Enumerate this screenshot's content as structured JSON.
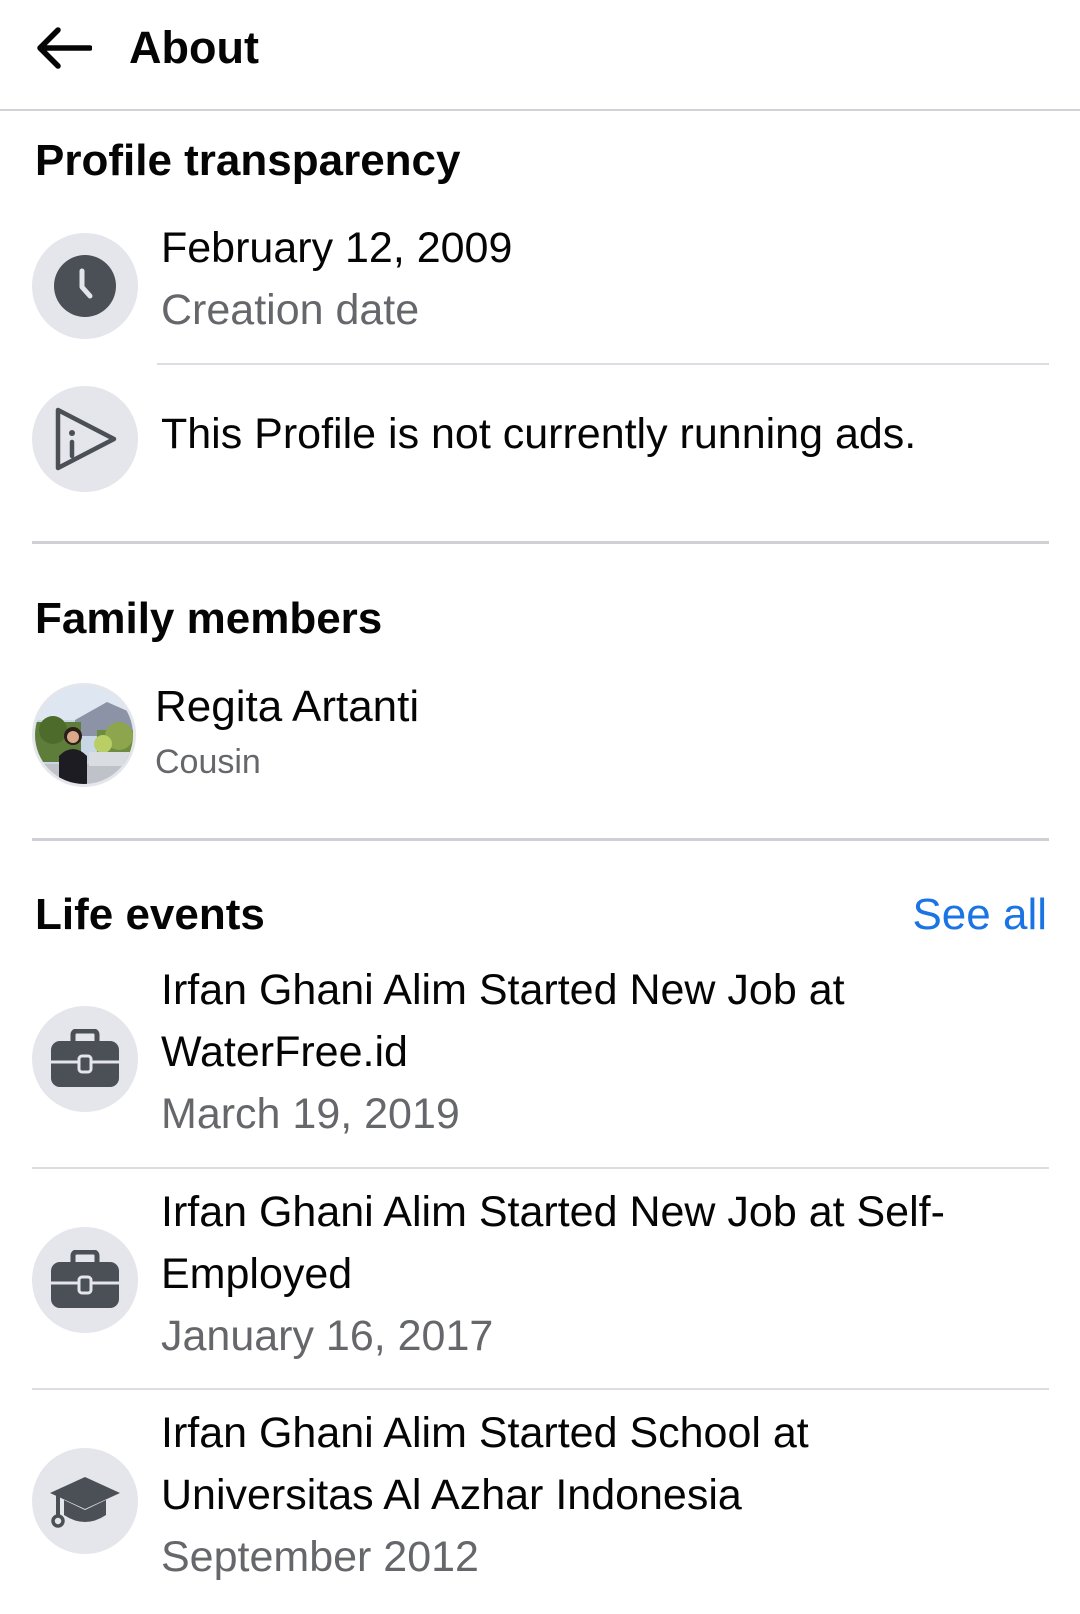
{
  "header": {
    "title": "About",
    "back_icon": "arrow-left-icon"
  },
  "profile_transparency": {
    "title": "Profile transparency",
    "creation": {
      "icon": "clock-icon",
      "date": "February 12, 2009",
      "label": "Creation date"
    },
    "ads": {
      "icon": "ads-play-icon",
      "text": "This Profile is not currently running ads."
    }
  },
  "family": {
    "title": "Family members",
    "member": {
      "name": "Regita Artanti",
      "relation": "Cousin"
    }
  },
  "life_events": {
    "title": "Life events",
    "see_all": "See all",
    "items": [
      {
        "icon": "briefcase-icon",
        "line1": "Irfan Ghani Alim Started New Job at",
        "line2": "WaterFree.id",
        "date": "March 19, 2019"
      },
      {
        "icon": "briefcase-icon",
        "line1": "Irfan Ghani Alim Started New Job at Self-",
        "line2": "Employed",
        "date": "January 16, 2017"
      },
      {
        "icon": "graduation-cap-icon",
        "line1": "Irfan Ghani Alim Started School at",
        "line2": "Universitas Al Azhar Indonesia",
        "date": "September 2012"
      }
    ]
  },
  "colors": {
    "accent": "#1b74e4",
    "icon": "#4b4f56",
    "icon_bg": "#e4e6eb",
    "secondary_text": "#65676b"
  }
}
